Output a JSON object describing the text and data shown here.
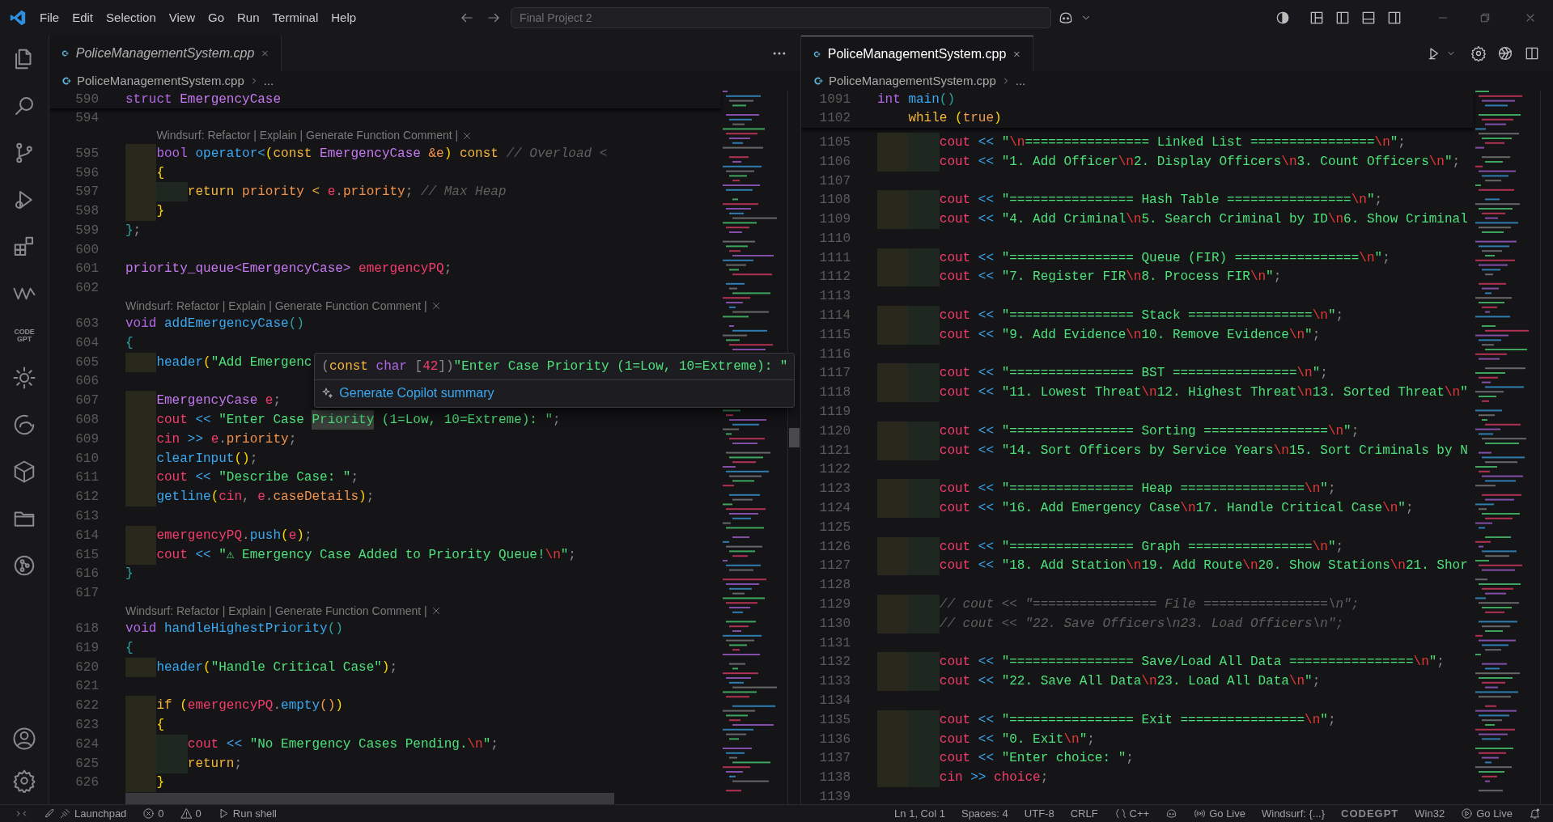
{
  "title_bar": {
    "menus": [
      "File",
      "Edit",
      "Selection",
      "View",
      "Go",
      "Run",
      "Terminal",
      "Help"
    ],
    "command_center": "Final Project 2"
  },
  "activity_bar": {
    "codegpt_label": "CODE GPT"
  },
  "editors": [
    {
      "tab": {
        "label": "PoliceManagementSystem.cpp",
        "selected": false,
        "preview": true
      },
      "breadcrumb": {
        "file": "PoliceManagementSystem.cpp",
        "more": "..."
      },
      "sticky_lines": [
        {
          "number": "590",
          "tokens": [
            {
              "kind": "kw",
              "text": "struct "
            },
            {
              "kind": "type",
              "text": "EmergencyCase"
            }
          ]
        }
      ],
      "lines": [
        {
          "kind": "code",
          "number": "594"
        },
        {
          "kind": "codelens",
          "text": "Windsurf: Refactor | Explain | Generate Function Comment |"
        },
        {
          "kind": "code",
          "number": "595",
          "tokens": [
            {
              "kind": "kw",
              "text": "    bool "
            },
            {
              "kind": "fn",
              "text": "operator<"
            },
            {
              "kind": "paren",
              "text": "("
            },
            {
              "kind": "ctl",
              "text": "const "
            },
            {
              "kind": "type",
              "text": "EmergencyCase "
            },
            {
              "kind": "prop",
              "text": "&e"
            },
            {
              "kind": "paren",
              "text": ") "
            },
            {
              "kind": "ctl",
              "text": "const "
            },
            {
              "kind": "cmt",
              "text": "// Overload <"
            }
          ]
        },
        {
          "kind": "code",
          "number": "596",
          "tokens": [
            {
              "kind": "paren",
              "text": "    {"
            }
          ]
        },
        {
          "kind": "code",
          "number": "597",
          "tokens": [
            {
              "kind": "ctl",
              "text": "        return "
            },
            {
              "kind": "prop",
              "text": "priority "
            },
            {
              "kind": "ctl",
              "text": "< "
            },
            {
              "kind": "var",
              "text": "e"
            },
            {
              "kind": "punc",
              "text": "."
            },
            {
              "kind": "prop",
              "text": "priority"
            },
            {
              "kind": "punc",
              "text": "; "
            },
            {
              "kind": "cmt",
              "text": "// Max Heap"
            }
          ]
        },
        {
          "kind": "code",
          "number": "598",
          "tokens": [
            {
              "kind": "paren",
              "text": "    }"
            }
          ]
        },
        {
          "kind": "code",
          "number": "599",
          "tokens": [
            {
              "kind": "paren2",
              "text": "}"
            },
            {
              "kind": "punc",
              "text": ";"
            }
          ]
        },
        {
          "kind": "code",
          "number": "600"
        },
        {
          "kind": "code",
          "number": "601",
          "tokens": [
            {
              "kind": "type",
              "text": "priority_queue<EmergencyCase> "
            },
            {
              "kind": "var",
              "text": "emergencyPQ"
            },
            {
              "kind": "punc",
              "text": ";"
            }
          ]
        },
        {
          "kind": "code",
          "number": "602"
        },
        {
          "kind": "codelens",
          "text": "Windsurf: Refactor | Explain | Generate Function Comment |"
        },
        {
          "kind": "code",
          "number": "603",
          "tokens": [
            {
              "kind": "kw",
              "text": "void "
            },
            {
              "kind": "fn",
              "text": "addEmergencyCase"
            },
            {
              "kind": "paren2",
              "text": "()"
            }
          ]
        },
        {
          "kind": "code",
          "number": "604",
          "tokens": [
            {
              "kind": "paren2",
              "text": "{"
            }
          ]
        },
        {
          "kind": "code",
          "number": "605",
          "tokens": [
            {
              "kind": "fn",
              "text": "    header"
            },
            {
              "kind": "paren",
              "text": "("
            },
            {
              "kind": "str",
              "text": "\"Add Emergenc"
            }
          ],
          "hover": {
            "signature": [
              {
                "kind": "punc",
                "text": "("
              },
              {
                "kind": "ctl",
                "text": "const "
              },
              {
                "kind": "kw",
                "text": "char "
              },
              {
                "kind": "punc",
                "text": "["
              },
              {
                "kind": "var",
                "text": "42"
              },
              {
                "kind": "punc",
                "text": "])"
              },
              {
                "kind": "str",
                "text": "\"Enter Case Priority (1=Low, 10=Extreme): \""
              }
            ],
            "action": "Generate Copilot summary"
          }
        },
        {
          "kind": "code",
          "number": "606"
        },
        {
          "kind": "code",
          "number": "607",
          "tokens": [
            {
              "kind": "type",
              "text": "    EmergencyCase "
            },
            {
              "kind": "var",
              "text": "e"
            },
            {
              "kind": "punc",
              "text": ";"
            }
          ]
        },
        {
          "kind": "code",
          "number": "608",
          "tokens": [
            {
              "kind": "var",
              "text": "    cout "
            },
            {
              "kind": "op",
              "text": "<< "
            },
            {
              "kind": "str",
              "text": "\"Enter Case "
            },
            {
              "kind": "mark",
              "text": "Priority"
            },
            {
              "kind": "str",
              "text": " (1=Low, 10=Extreme): \""
            },
            {
              "kind": "punc",
              "text": ";"
            }
          ]
        },
        {
          "kind": "code",
          "number": "609",
          "tokens": [
            {
              "kind": "var",
              "text": "    cin "
            },
            {
              "kind": "op",
              "text": ">> "
            },
            {
              "kind": "var",
              "text": "e"
            },
            {
              "kind": "punc",
              "text": "."
            },
            {
              "kind": "prop",
              "text": "priority"
            },
            {
              "kind": "punc",
              "text": ";"
            }
          ]
        },
        {
          "kind": "code",
          "number": "610",
          "tokens": [
            {
              "kind": "fn",
              "text": "    clearInput"
            },
            {
              "kind": "paren",
              "text": "()"
            },
            {
              "kind": "punc",
              "text": ";"
            }
          ]
        },
        {
          "kind": "code",
          "number": "611",
          "tokens": [
            {
              "kind": "var",
              "text": "    cout "
            },
            {
              "kind": "op",
              "text": "<< "
            },
            {
              "kind": "str",
              "text": "\"Describe Case: \""
            },
            {
              "kind": "punc",
              "text": ";"
            }
          ]
        },
        {
          "kind": "code",
          "number": "612",
          "tokens": [
            {
              "kind": "fn",
              "text": "    getline"
            },
            {
              "kind": "paren",
              "text": "("
            },
            {
              "kind": "var",
              "text": "cin"
            },
            {
              "kind": "punc",
              "text": ", "
            },
            {
              "kind": "var",
              "text": "e"
            },
            {
              "kind": "punc",
              "text": "."
            },
            {
              "kind": "prop",
              "text": "caseDetails"
            },
            {
              "kind": "paren",
              "text": ")"
            },
            {
              "kind": "punc",
              "text": ";"
            }
          ]
        },
        {
          "kind": "code",
          "number": "613"
        },
        {
          "kind": "code",
          "number": "614",
          "tokens": [
            {
              "kind": "var",
              "text": "    emergencyPQ"
            },
            {
              "kind": "punc",
              "text": "."
            },
            {
              "kind": "fn",
              "text": "push"
            },
            {
              "kind": "paren",
              "text": "("
            },
            {
              "kind": "var",
              "text": "e"
            },
            {
              "kind": "paren",
              "text": ")"
            },
            {
              "kind": "punc",
              "text": ";"
            }
          ]
        },
        {
          "kind": "code",
          "number": "615",
          "tokens": [
            {
              "kind": "var",
              "text": "    cout "
            },
            {
              "kind": "op",
              "text": "<< "
            },
            {
              "kind": "str",
              "text": "\"⚠ Emergency Case Added to Priority Queue!"
            },
            {
              "kind": "esc",
              "text": "\\n"
            },
            {
              "kind": "str",
              "text": "\""
            },
            {
              "kind": "punc",
              "text": ";"
            }
          ]
        },
        {
          "kind": "code",
          "number": "616",
          "tokens": [
            {
              "kind": "paren2",
              "text": "}"
            }
          ]
        },
        {
          "kind": "code",
          "number": "617"
        },
        {
          "kind": "codelens",
          "text": "Windsurf: Refactor | Explain | Generate Function Comment |"
        },
        {
          "kind": "code",
          "number": "618",
          "tokens": [
            {
              "kind": "kw",
              "text": "void "
            },
            {
              "kind": "fn",
              "text": "handleHighestPriority"
            },
            {
              "kind": "paren2",
              "text": "()"
            }
          ]
        },
        {
          "kind": "code",
          "number": "619",
          "tokens": [
            {
              "kind": "paren2",
              "text": "{"
            }
          ]
        },
        {
          "kind": "code",
          "number": "620",
          "tokens": [
            {
              "kind": "fn",
              "text": "    header"
            },
            {
              "kind": "paren",
              "text": "("
            },
            {
              "kind": "str",
              "text": "\"Handle Critical Case\""
            },
            {
              "kind": "paren",
              "text": ")"
            },
            {
              "kind": "punc",
              "text": ";"
            }
          ]
        },
        {
          "kind": "code",
          "number": "621"
        },
        {
          "kind": "code",
          "number": "622",
          "tokens": [
            {
              "kind": "ctl",
              "text": "    if "
            },
            {
              "kind": "paren",
              "text": "("
            },
            {
              "kind": "var",
              "text": "emergencyPQ"
            },
            {
              "kind": "punc",
              "text": "."
            },
            {
              "kind": "fn",
              "text": "empty"
            },
            {
              "kind": "lit",
              "text": "()"
            },
            {
              "kind": "paren",
              "text": ")"
            }
          ]
        },
        {
          "kind": "code",
          "number": "623",
          "tokens": [
            {
              "kind": "paren",
              "text": "    {"
            }
          ]
        },
        {
          "kind": "code",
          "number": "624",
          "tokens": [
            {
              "kind": "var",
              "text": "        cout "
            },
            {
              "kind": "op",
              "text": "<< "
            },
            {
              "kind": "str",
              "text": "\"No Emergency Cases Pending."
            },
            {
              "kind": "esc",
              "text": "\\n"
            },
            {
              "kind": "str",
              "text": "\""
            },
            {
              "kind": "punc",
              "text": ";"
            }
          ]
        },
        {
          "kind": "code",
          "number": "625",
          "tokens": [
            {
              "kind": "ctl",
              "text": "        return"
            },
            {
              "kind": "punc",
              "text": ";"
            }
          ]
        },
        {
          "kind": "code",
          "number": "626",
          "tokens": [
            {
              "kind": "paren",
              "text": "    }"
            }
          ]
        }
      ]
    },
    {
      "tab": {
        "label": "PoliceManagementSystem.cpp",
        "selected": true,
        "preview": false
      },
      "breadcrumb": {
        "file": "PoliceManagementSystem.cpp",
        "more": "..."
      },
      "sticky_lines": [
        {
          "number": "1091",
          "tokens": [
            {
              "kind": "kw",
              "text": "int "
            },
            {
              "kind": "fn",
              "text": "main"
            },
            {
              "kind": "paren2",
              "text": "()"
            }
          ]
        },
        {
          "number": "1102",
          "tokens": [
            {
              "kind": "ctl",
              "text": "    while "
            },
            {
              "kind": "paren",
              "text": "("
            },
            {
              "kind": "lit",
              "text": "true"
            },
            {
              "kind": "paren",
              "text": ")"
            }
          ]
        }
      ],
      "lines": [
        {
          "kind": "code",
          "number": "1105",
          "tokens": [
            {
              "kind": "var",
              "text": "        cout "
            },
            {
              "kind": "op",
              "text": "<< "
            },
            {
              "kind": "str",
              "text": "\""
            },
            {
              "kind": "esc",
              "text": "\\n"
            },
            {
              "kind": "str",
              "text": "================ Linked List ================"
            },
            {
              "kind": "esc",
              "text": "\\n"
            },
            {
              "kind": "str",
              "text": "\""
            },
            {
              "kind": "punc",
              "text": ";"
            }
          ]
        },
        {
          "kind": "code",
          "number": "1106",
          "tokens": [
            {
              "kind": "var",
              "text": "        cout "
            },
            {
              "kind": "op",
              "text": "<< "
            },
            {
              "kind": "str",
              "text": "\"1. Add Officer"
            },
            {
              "kind": "esc",
              "text": "\\n"
            },
            {
              "kind": "str",
              "text": "2. Display Officers"
            },
            {
              "kind": "esc",
              "text": "\\n"
            },
            {
              "kind": "str",
              "text": "3. Count Officers"
            },
            {
              "kind": "esc",
              "text": "\\n"
            },
            {
              "kind": "str",
              "text": "\""
            },
            {
              "kind": "punc",
              "text": ";"
            }
          ]
        },
        {
          "kind": "code",
          "number": "1107"
        },
        {
          "kind": "code",
          "number": "1108",
          "tokens": [
            {
              "kind": "var",
              "text": "        cout "
            },
            {
              "kind": "op",
              "text": "<< "
            },
            {
              "kind": "str",
              "text": "\"================ Hash Table ================"
            },
            {
              "kind": "esc",
              "text": "\\n"
            },
            {
              "kind": "str",
              "text": "\""
            },
            {
              "kind": "punc",
              "text": ";"
            }
          ]
        },
        {
          "kind": "code",
          "number": "1109",
          "tokens": [
            {
              "kind": "var",
              "text": "        cout "
            },
            {
              "kind": "op",
              "text": "<< "
            },
            {
              "kind": "str",
              "text": "\"4. Add Criminal"
            },
            {
              "kind": "esc",
              "text": "\\n"
            },
            {
              "kind": "str",
              "text": "5. Search Criminal by ID"
            },
            {
              "kind": "esc",
              "text": "\\n"
            },
            {
              "kind": "str",
              "text": "6. Show Criminal"
            }
          ]
        },
        {
          "kind": "code",
          "number": "1110"
        },
        {
          "kind": "code",
          "number": "1111",
          "tokens": [
            {
              "kind": "var",
              "text": "        cout "
            },
            {
              "kind": "op",
              "text": "<< "
            },
            {
              "kind": "str",
              "text": "\"================ Queue (FIR) ================"
            },
            {
              "kind": "esc",
              "text": "\\n"
            },
            {
              "kind": "str",
              "text": "\""
            },
            {
              "kind": "punc",
              "text": ";"
            }
          ]
        },
        {
          "kind": "code",
          "number": "1112",
          "tokens": [
            {
              "kind": "var",
              "text": "        cout "
            },
            {
              "kind": "op",
              "text": "<< "
            },
            {
              "kind": "str",
              "text": "\"7. Register FIR"
            },
            {
              "kind": "esc",
              "text": "\\n"
            },
            {
              "kind": "str",
              "text": "8. Process FIR"
            },
            {
              "kind": "esc",
              "text": "\\n"
            },
            {
              "kind": "str",
              "text": "\""
            },
            {
              "kind": "punc",
              "text": ";"
            }
          ]
        },
        {
          "kind": "code",
          "number": "1113"
        },
        {
          "kind": "code",
          "number": "1114",
          "tokens": [
            {
              "kind": "var",
              "text": "        cout "
            },
            {
              "kind": "op",
              "text": "<< "
            },
            {
              "kind": "str",
              "text": "\"================ Stack ================"
            },
            {
              "kind": "esc",
              "text": "\\n"
            },
            {
              "kind": "str",
              "text": "\""
            },
            {
              "kind": "punc",
              "text": ";"
            }
          ]
        },
        {
          "kind": "code",
          "number": "1115",
          "tokens": [
            {
              "kind": "var",
              "text": "        cout "
            },
            {
              "kind": "op",
              "text": "<< "
            },
            {
              "kind": "str",
              "text": "\"9. Add Evidence"
            },
            {
              "kind": "esc",
              "text": "\\n"
            },
            {
              "kind": "str",
              "text": "10. Remove Evidence"
            },
            {
              "kind": "esc",
              "text": "\\n"
            },
            {
              "kind": "str",
              "text": "\""
            },
            {
              "kind": "punc",
              "text": ";"
            }
          ]
        },
        {
          "kind": "code",
          "number": "1116"
        },
        {
          "kind": "code",
          "number": "1117",
          "tokens": [
            {
              "kind": "var",
              "text": "        cout "
            },
            {
              "kind": "op",
              "text": "<< "
            },
            {
              "kind": "str",
              "text": "\"================ BST ================"
            },
            {
              "kind": "esc",
              "text": "\\n"
            },
            {
              "kind": "str",
              "text": "\""
            },
            {
              "kind": "punc",
              "text": ";"
            }
          ]
        },
        {
          "kind": "code",
          "number": "1118",
          "tokens": [
            {
              "kind": "var",
              "text": "        cout "
            },
            {
              "kind": "op",
              "text": "<< "
            },
            {
              "kind": "str",
              "text": "\"11. Lowest Threat"
            },
            {
              "kind": "esc",
              "text": "\\n"
            },
            {
              "kind": "str",
              "text": "12. Highest Threat"
            },
            {
              "kind": "esc",
              "text": "\\n"
            },
            {
              "kind": "str",
              "text": "13. Sorted Threat"
            },
            {
              "kind": "esc",
              "text": "\\n"
            },
            {
              "kind": "str",
              "text": "\""
            }
          ]
        },
        {
          "kind": "code",
          "number": "1119"
        },
        {
          "kind": "code",
          "number": "1120",
          "tokens": [
            {
              "kind": "var",
              "text": "        cout "
            },
            {
              "kind": "op",
              "text": "<< "
            },
            {
              "kind": "str",
              "text": "\"================ Sorting ================"
            },
            {
              "kind": "esc",
              "text": "\\n"
            },
            {
              "kind": "str",
              "text": "\""
            },
            {
              "kind": "punc",
              "text": ";"
            }
          ]
        },
        {
          "kind": "code",
          "number": "1121",
          "tokens": [
            {
              "kind": "var",
              "text": "        cout "
            },
            {
              "kind": "op",
              "text": "<< "
            },
            {
              "kind": "str",
              "text": "\"14. Sort Officers by Service Years"
            },
            {
              "kind": "esc",
              "text": "\\n"
            },
            {
              "kind": "str",
              "text": "15. Sort Criminals by N"
            }
          ]
        },
        {
          "kind": "code",
          "number": "1122"
        },
        {
          "kind": "code",
          "number": "1123",
          "tokens": [
            {
              "kind": "var",
              "text": "        cout "
            },
            {
              "kind": "op",
              "text": "<< "
            },
            {
              "kind": "str",
              "text": "\"================ Heap ================"
            },
            {
              "kind": "esc",
              "text": "\\n"
            },
            {
              "kind": "str",
              "text": "\""
            },
            {
              "kind": "punc",
              "text": ";"
            }
          ]
        },
        {
          "kind": "code",
          "number": "1124",
          "tokens": [
            {
              "kind": "var",
              "text": "        cout "
            },
            {
              "kind": "op",
              "text": "<< "
            },
            {
              "kind": "str",
              "text": "\"16. Add Emergency Case"
            },
            {
              "kind": "esc",
              "text": "\\n"
            },
            {
              "kind": "str",
              "text": "17. Handle Critical Case"
            },
            {
              "kind": "esc",
              "text": "\\n"
            },
            {
              "kind": "str",
              "text": "\""
            },
            {
              "kind": "punc",
              "text": ";"
            }
          ]
        },
        {
          "kind": "code",
          "number": "1125"
        },
        {
          "kind": "code",
          "number": "1126",
          "tokens": [
            {
              "kind": "var",
              "text": "        cout "
            },
            {
              "kind": "op",
              "text": "<< "
            },
            {
              "kind": "str",
              "text": "\"================ Graph ================"
            },
            {
              "kind": "esc",
              "text": "\\n"
            },
            {
              "kind": "str",
              "text": "\""
            },
            {
              "kind": "punc",
              "text": ";"
            }
          ]
        },
        {
          "kind": "code",
          "number": "1127",
          "tokens": [
            {
              "kind": "var",
              "text": "        cout "
            },
            {
              "kind": "op",
              "text": "<< "
            },
            {
              "kind": "str",
              "text": "\"18. Add Station"
            },
            {
              "kind": "esc",
              "text": "\\n"
            },
            {
              "kind": "str",
              "text": "19. Add Route"
            },
            {
              "kind": "esc",
              "text": "\\n"
            },
            {
              "kind": "str",
              "text": "20. Show Stations"
            },
            {
              "kind": "esc",
              "text": "\\n"
            },
            {
              "kind": "str",
              "text": "21. Shor"
            }
          ]
        },
        {
          "kind": "code",
          "number": "1128"
        },
        {
          "kind": "code",
          "number": "1129",
          "tokens": [
            {
              "kind": "cmt",
              "text": "        // cout << \"================ File ================\\n\";"
            }
          ]
        },
        {
          "kind": "code",
          "number": "1130",
          "tokens": [
            {
              "kind": "cmt",
              "text": "        // cout << \"22. Save Officers\\n23. Load Officers\\n\";"
            }
          ]
        },
        {
          "kind": "code",
          "number": "1131"
        },
        {
          "kind": "code",
          "number": "1132",
          "tokens": [
            {
              "kind": "var",
              "text": "        cout "
            },
            {
              "kind": "op",
              "text": "<< "
            },
            {
              "kind": "str",
              "text": "\"================ Save/Load All Data ================"
            },
            {
              "kind": "esc",
              "text": "\\n"
            },
            {
              "kind": "str",
              "text": "\""
            },
            {
              "kind": "punc",
              "text": ";"
            }
          ]
        },
        {
          "kind": "code",
          "number": "1133",
          "tokens": [
            {
              "kind": "var",
              "text": "        cout "
            },
            {
              "kind": "op",
              "text": "<< "
            },
            {
              "kind": "str",
              "text": "\"22. Save All Data"
            },
            {
              "kind": "esc",
              "text": "\\n"
            },
            {
              "kind": "str",
              "text": "23. Load All Data"
            },
            {
              "kind": "esc",
              "text": "\\n"
            },
            {
              "kind": "str",
              "text": "\""
            },
            {
              "kind": "punc",
              "text": ";"
            }
          ]
        },
        {
          "kind": "code",
          "number": "1134"
        },
        {
          "kind": "code",
          "number": "1135",
          "tokens": [
            {
              "kind": "var",
              "text": "        cout "
            },
            {
              "kind": "op",
              "text": "<< "
            },
            {
              "kind": "str",
              "text": "\"================ Exit ================"
            },
            {
              "kind": "esc",
              "text": "\\n"
            },
            {
              "kind": "str",
              "text": "\""
            },
            {
              "kind": "punc",
              "text": ";"
            }
          ]
        },
        {
          "kind": "code",
          "number": "1136",
          "tokens": [
            {
              "kind": "var",
              "text": "        cout "
            },
            {
              "kind": "op",
              "text": "<< "
            },
            {
              "kind": "str",
              "text": "\"0. Exit"
            },
            {
              "kind": "esc",
              "text": "\\n"
            },
            {
              "kind": "str",
              "text": "\""
            },
            {
              "kind": "punc",
              "text": ";"
            }
          ]
        },
        {
          "kind": "code",
          "number": "1137",
          "tokens": [
            {
              "kind": "var",
              "text": "        cout "
            },
            {
              "kind": "op",
              "text": "<< "
            },
            {
              "kind": "str",
              "text": "\"Enter choice: \""
            },
            {
              "kind": "punc",
              "text": ";"
            }
          ]
        },
        {
          "kind": "code",
          "number": "1138",
          "tokens": [
            {
              "kind": "var",
              "text": "        cin "
            },
            {
              "kind": "op",
              "text": ">> "
            },
            {
              "kind": "var",
              "text": "choice"
            },
            {
              "kind": "punc",
              "text": ";"
            }
          ]
        },
        {
          "kind": "code",
          "number": "1139"
        }
      ]
    }
  ],
  "status_bar": {
    "left": [
      {
        "kind": "remote"
      },
      {
        "kind": "launchpad",
        "text": "Launchpad"
      },
      {
        "kind": "errors",
        "text": "0"
      },
      {
        "kind": "warnings",
        "text": "0"
      },
      {
        "kind": "run",
        "text": "Run shell"
      }
    ],
    "right": [
      {
        "kind": "text",
        "text": "Ln 1, Col 1"
      },
      {
        "kind": "text",
        "text": "Spaces: 4"
      },
      {
        "kind": "text",
        "text": "UTF-8"
      },
      {
        "kind": "text",
        "text": "CRLF"
      },
      {
        "kind": "language",
        "text": "C++"
      },
      {
        "kind": "copilot"
      },
      {
        "kind": "broadcast",
        "text": "Go Live"
      },
      {
        "kind": "text",
        "text": "Windsurf: {...}"
      },
      {
        "kind": "logo",
        "text": "CODEGPT"
      },
      {
        "kind": "text",
        "text": "Win32"
      },
      {
        "kind": "play",
        "text": "Go Live"
      },
      {
        "kind": "bell"
      }
    ]
  }
}
